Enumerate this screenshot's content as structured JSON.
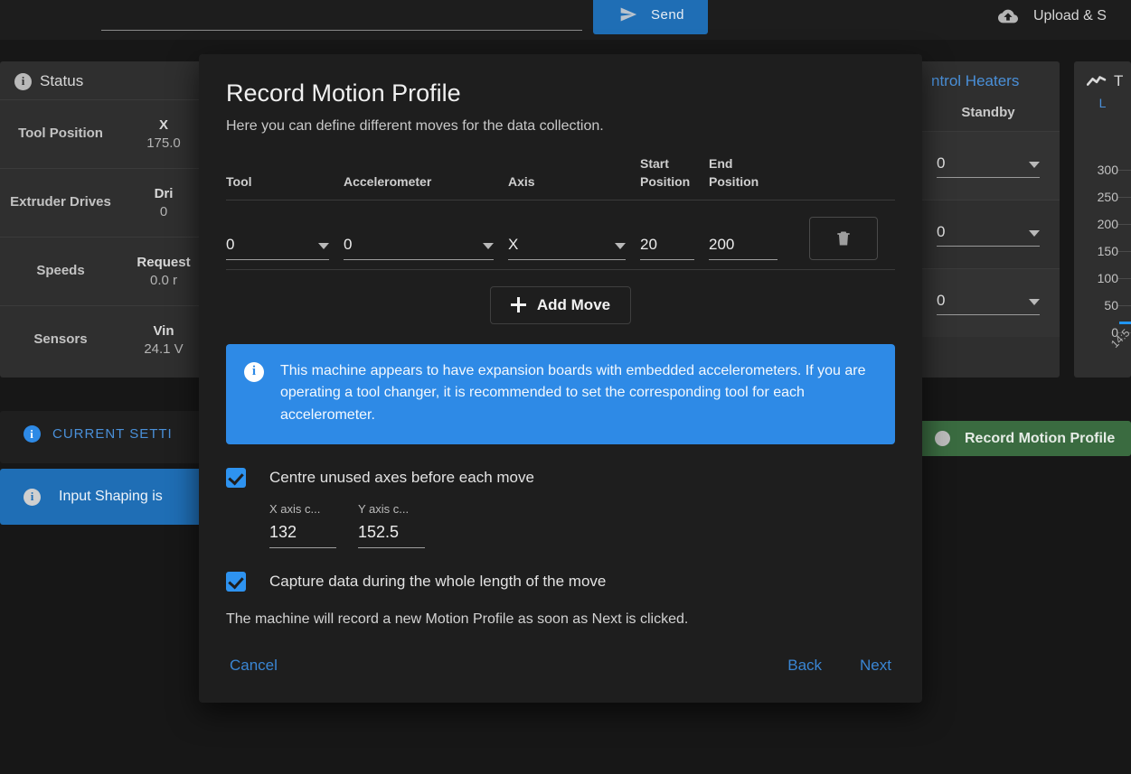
{
  "topbar": {
    "gcode_placeholder": "",
    "gcode_value": "",
    "send_label": "Send",
    "send_icon": "send-icon",
    "upload_label": "Upload & S",
    "upload_icon": "cloud-upload-icon"
  },
  "status_panel": {
    "title": "Status",
    "icon": "info-circle-icon",
    "rows": [
      {
        "label": "Tool Position",
        "value_head": "X",
        "value": "175.0"
      },
      {
        "label": "Extruder Drives",
        "value_head": "Dri",
        "value": "0"
      },
      {
        "label": "Speeds",
        "value_head": "Request",
        "value": "0.0 r"
      },
      {
        "label": "Sensors",
        "value_head": "Vin",
        "value": "24.1 V"
      }
    ]
  },
  "settings_panel": {
    "title": "CURRENT SETTI",
    "icon": "info-circle-icon"
  },
  "shaping_banner": {
    "text": "Input Shaping is",
    "icon": "info-circle-icon",
    "color": "#1f6eb5"
  },
  "heaters_panel": {
    "title": "ntrol Heaters",
    "subheader": "Standby",
    "rows": [
      {
        "value": "0"
      },
      {
        "value": "0"
      },
      {
        "value": "0"
      }
    ]
  },
  "chart_panel": {
    "title": "T",
    "icon": "chart-line-icon",
    "legend": "L"
  },
  "chart_data": {
    "type": "line",
    "title": "T",
    "xlabel": "",
    "ylabel": "",
    "ylim": [
      0,
      300
    ],
    "yticks": [
      300,
      250,
      200,
      150,
      100,
      50,
      0
    ],
    "xticks": [
      "14:5"
    ],
    "grid": true,
    "legend_position": "top",
    "series": [
      {
        "name": "L",
        "color": "#2196f3",
        "values": [
          22,
          22
        ]
      }
    ]
  },
  "record_button": {
    "label": "Record Motion Profile",
    "icon": "record-dot-icon",
    "color": "#3a6b40"
  },
  "modal": {
    "title": "Record Motion Profile",
    "subtitle": "Here you can define different moves for the data collection.",
    "table": {
      "columns": [
        "Tool",
        "Accelerometer",
        "Axis",
        "Start Position",
        "End Position"
      ],
      "columns_split": [
        {
          "line1": "Tool",
          "line2": ""
        },
        {
          "line1": "Accelerometer",
          "line2": ""
        },
        {
          "line1": "Axis",
          "line2": ""
        },
        {
          "line1": "Start",
          "line2": "Position"
        },
        {
          "line1": "End",
          "line2": "Position"
        }
      ],
      "rows": [
        {
          "tool": "0",
          "accelerometer": "0",
          "axis": "X",
          "start_position": "20",
          "end_position": "200",
          "delete_icon": "trash-icon"
        }
      ]
    },
    "add_move_label": "Add Move",
    "add_move_icon": "plus-icon",
    "alert": {
      "icon": "info-circle-icon",
      "text": "This machine appears to have expansion boards with embedded accelerometers. If you are operating a tool changer, it is recommended to set the corresponding tool for each accelerometer.",
      "color": "#2e8ae6"
    },
    "centre_axes": {
      "label": "Centre unused axes before each move",
      "checked": true,
      "fields": [
        {
          "label": "X axis c...",
          "value": "132"
        },
        {
          "label": "Y axis c...",
          "value": "152.5"
        }
      ]
    },
    "capture_data": {
      "label": "Capture data during the whole length of the move",
      "checked": true
    },
    "note": "The machine will record a new Motion Profile as soon as Next is clicked.",
    "buttons": {
      "cancel": "Cancel",
      "back": "Back",
      "next": "Next"
    },
    "accent_color": "#3a86d4"
  }
}
